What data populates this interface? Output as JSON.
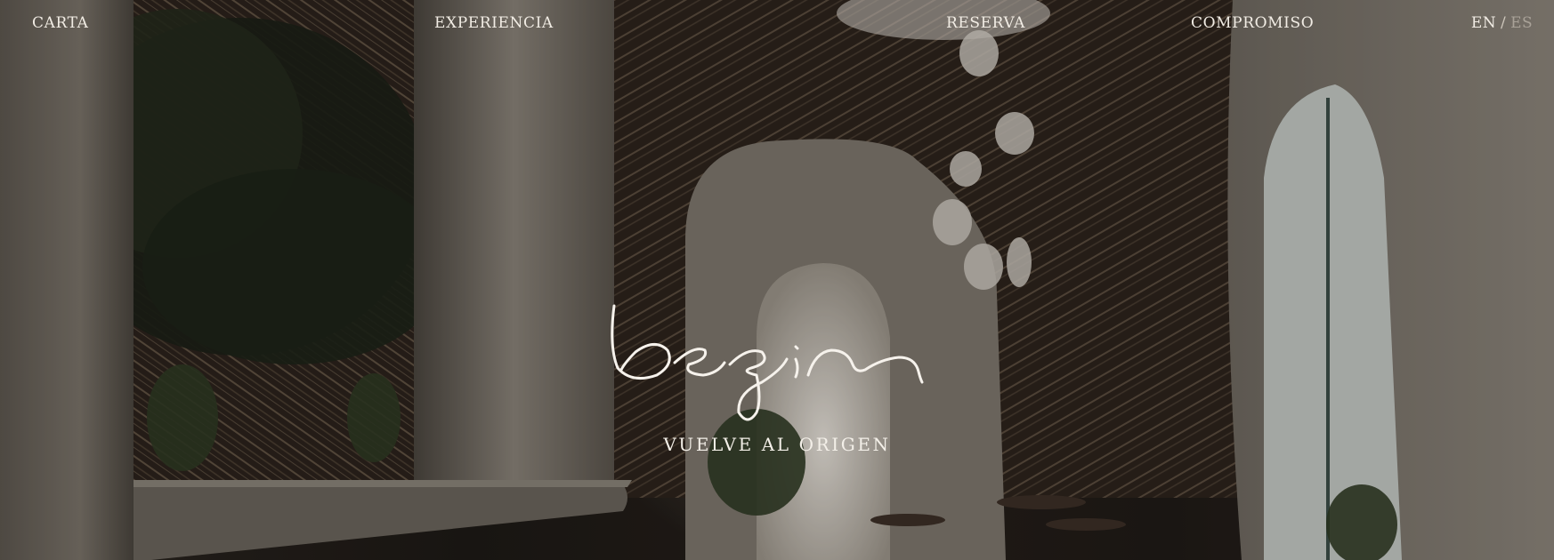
{
  "nav": {
    "items": [
      {
        "label": "CARTA"
      },
      {
        "label": "EXPERIENCIA"
      },
      {
        "label": "RESERVA"
      },
      {
        "label": "COMPROMISO"
      }
    ],
    "language": {
      "options": [
        "EN",
        "ES"
      ],
      "separator": "/",
      "selected": "EN"
    }
  },
  "hero": {
    "logo_text": "begin",
    "tagline": "VUELVE AL ORIGEN"
  },
  "colors": {
    "text": "#f1ece4",
    "inactive_text": "#a9a298",
    "background": "#1b1713"
  }
}
